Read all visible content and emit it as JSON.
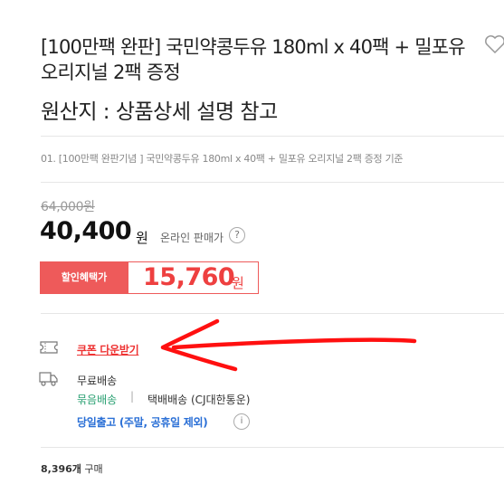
{
  "product": {
    "title": "[100만팩 완판] 국민약콩두유 180ml x 40팩 + 밀포유 오리지널 2팩 증정",
    "origin": "원산지 : 상품상세 설명 참고",
    "option": "01. [100만팩 완판기념 ] 국민약콩두유 180ml x 40팩 + 밀포유 오리지널 2팩 증정 기준"
  },
  "price": {
    "original": "64,000원",
    "current": "40,400",
    "unit": "원",
    "online_label": "온라인 판매가",
    "help_icon": "?",
    "discount_label": "할인혜택가",
    "discount_price": "15,760",
    "discount_unit": "원"
  },
  "coupon": {
    "label": "쿠폰 다운받기"
  },
  "delivery": {
    "free": "무료배송",
    "bundle": "묶음배송",
    "separator": "|",
    "courier": "택배배송 (CJ대한통운)",
    "sameday": "당일출고 (주말, 공휴일 제외)",
    "info_icon": "i"
  },
  "sales": {
    "count": "8,396개",
    "label": "구매"
  },
  "icons": {
    "wishlist": "heart-icon",
    "coupon": "coupon-icon",
    "delivery": "truck-icon"
  },
  "colors": {
    "accent": "#ee5a5a",
    "bundle": "#2aa072",
    "sameday": "#2a6fd6",
    "annotation": "#ff0000"
  }
}
